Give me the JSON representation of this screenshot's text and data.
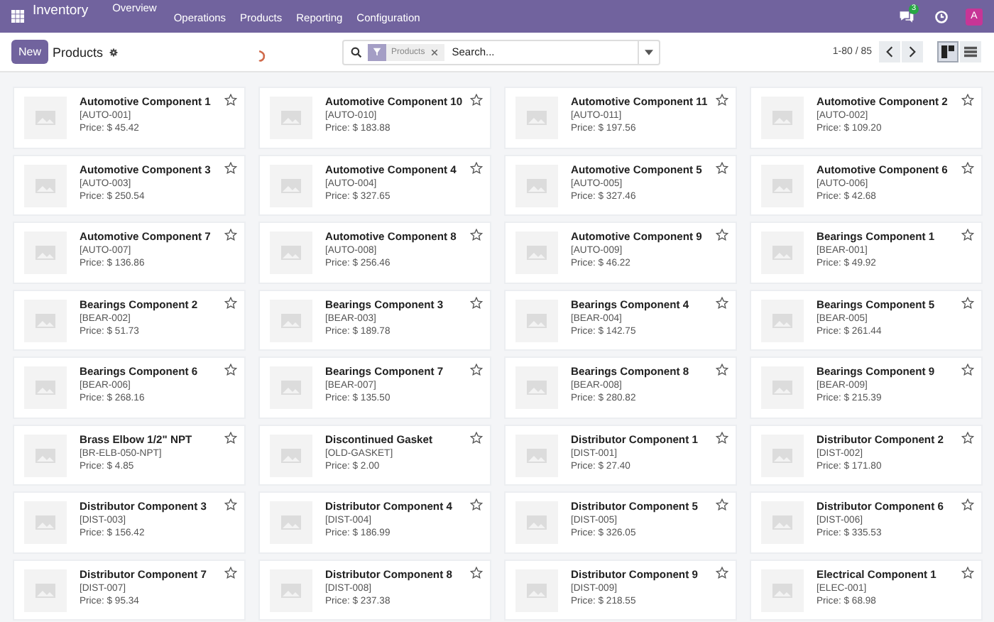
{
  "navbar": {
    "app_name": "Inventory",
    "overview": "Overview",
    "menus": [
      "Operations",
      "Products",
      "Reporting",
      "Configuration"
    ],
    "chat_badge": "3",
    "avatar": "A"
  },
  "control_panel": {
    "new_button": "New",
    "title": "Products",
    "search": {
      "facet": "Products",
      "placeholder": "Search..."
    },
    "pager": "1-80 / 85",
    "views": [
      {
        "kind": "kanban",
        "selected": true
      },
      {
        "kind": "list",
        "selected": false
      }
    ]
  },
  "products": [
    {
      "name": "Automotive Component 1",
      "code": "[AUTO-001]",
      "price": "Price: $ 45.42",
      "favorite": false
    },
    {
      "name": "Automotive Component 10",
      "code": "[AUTO-010]",
      "price": "Price: $ 183.88",
      "favorite": false
    },
    {
      "name": "Automotive Component 11",
      "code": "[AUTO-011]",
      "price": "Price: $ 197.56",
      "favorite": false
    },
    {
      "name": "Automotive Component 2",
      "code": "[AUTO-002]",
      "price": "Price: $ 109.20",
      "favorite": false
    },
    {
      "name": "Automotive Component 3",
      "code": "[AUTO-003]",
      "price": "Price: $ 250.54",
      "favorite": false
    },
    {
      "name": "Automotive Component 4",
      "code": "[AUTO-004]",
      "price": "Price: $ 327.65",
      "favorite": false
    },
    {
      "name": "Automotive Component 5",
      "code": "[AUTO-005]",
      "price": "Price: $ 327.46",
      "favorite": false
    },
    {
      "name": "Automotive Component 6",
      "code": "[AUTO-006]",
      "price": "Price: $ 42.68",
      "favorite": false
    },
    {
      "name": "Automotive Component 7",
      "code": "[AUTO-007]",
      "price": "Price: $ 136.86",
      "favorite": false
    },
    {
      "name": "Automotive Component 8",
      "code": "[AUTO-008]",
      "price": "Price: $ 256.46",
      "favorite": false
    },
    {
      "name": "Automotive Component 9",
      "code": "[AUTO-009]",
      "price": "Price: $ 46.22",
      "favorite": false
    },
    {
      "name": "Bearings Component 1",
      "code": "[BEAR-001]",
      "price": "Price: $ 49.92",
      "favorite": false
    },
    {
      "name": "Bearings Component 2",
      "code": "[BEAR-002]",
      "price": "Price: $ 51.73",
      "favorite": false
    },
    {
      "name": "Bearings Component 3",
      "code": "[BEAR-003]",
      "price": "Price: $ 189.78",
      "favorite": false
    },
    {
      "name": "Bearings Component 4",
      "code": "[BEAR-004]",
      "price": "Price: $ 142.75",
      "favorite": false
    },
    {
      "name": "Bearings Component 5",
      "code": "[BEAR-005]",
      "price": "Price: $ 261.44",
      "favorite": false
    },
    {
      "name": "Bearings Component 6",
      "code": "[BEAR-006]",
      "price": "Price: $ 268.16",
      "favorite": false
    },
    {
      "name": "Bearings Component 7",
      "code": "[BEAR-007]",
      "price": "Price: $ 135.50",
      "favorite": false
    },
    {
      "name": "Bearings Component 8",
      "code": "[BEAR-008]",
      "price": "Price: $ 280.82",
      "favorite": false
    },
    {
      "name": "Bearings Component 9",
      "code": "[BEAR-009]",
      "price": "Price: $ 215.39",
      "favorite": false
    },
    {
      "name": "Brass Elbow 1/2\" NPT",
      "code": "[BR-ELB-050-NPT]",
      "price": "Price: $ 4.85",
      "favorite": false
    },
    {
      "name": "Discontinued Gasket",
      "code": "[OLD-GASKET]",
      "price": "Price: $ 2.00",
      "favorite": false
    },
    {
      "name": "Distributor Component 1",
      "code": "[DIST-001]",
      "price": "Price: $ 27.40",
      "favorite": false
    },
    {
      "name": "Distributor Component 2",
      "code": "[DIST-002]",
      "price": "Price: $ 171.80",
      "favorite": false
    },
    {
      "name": "Distributor Component 3",
      "code": "[DIST-003]",
      "price": "Price: $ 156.42",
      "favorite": false
    },
    {
      "name": "Distributor Component 4",
      "code": "[DIST-004]",
      "price": "Price: $ 186.99",
      "favorite": false
    },
    {
      "name": "Distributor Component 5",
      "code": "[DIST-005]",
      "price": "Price: $ 326.05",
      "favorite": false
    },
    {
      "name": "Distributor Component 6",
      "code": "[DIST-006]",
      "price": "Price: $ 335.53",
      "favorite": false
    },
    {
      "name": "Distributor Component 7",
      "code": "[DIST-007]",
      "price": "Price: $ 95.34",
      "favorite": false
    },
    {
      "name": "Distributor Component 8",
      "code": "[DIST-008]",
      "price": "Price: $ 237.38",
      "favorite": false
    },
    {
      "name": "Distributor Component 9",
      "code": "[DIST-009]",
      "price": "Price: $ 218.55",
      "favorite": false
    },
    {
      "name": "Electrical Component 1",
      "code": "[ELEC-001]",
      "price": "Price: $ 68.98",
      "favorite": false
    }
  ]
}
